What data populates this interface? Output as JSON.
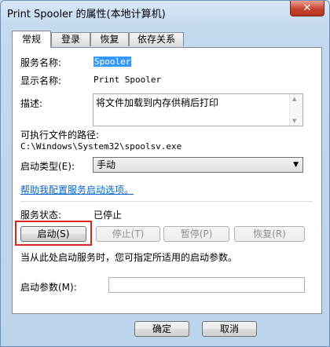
{
  "window": {
    "title": "Print Spooler 的属性(本地计算机)",
    "close_glyph": "✕"
  },
  "tabs": [
    {
      "label": "常规",
      "active": true
    },
    {
      "label": "登录",
      "active": false
    },
    {
      "label": "恢复",
      "active": false
    },
    {
      "label": "依存关系",
      "active": false
    }
  ],
  "general": {
    "service_name_label": "服务名称:",
    "service_name_value": "Spooler",
    "display_name_label": "显示名称:",
    "display_name_value": "Print Spooler",
    "description_label": "描述:",
    "description_value": "将文件加载到内存供稍后打印",
    "exe_path_label": "可执行文件的路径:",
    "exe_path_value": "C:\\Windows\\System32\\spoolsv.exe",
    "startup_type_label": "启动类型(E):",
    "startup_type_value": "手动",
    "help_link": "帮助我配置服务启动选项。",
    "status_label": "服务状态:",
    "status_value": "已停止",
    "start_button": "启动(S)",
    "stop_button": "停止(T)",
    "pause_button": "暂停(P)",
    "resume_button": "恢复(R)",
    "hint_text": "当从此处启动服务时，您可指定所适用的启动参数。",
    "start_params_label": "启动参数(M):",
    "start_params_value": ""
  },
  "footer": {
    "ok_button": "确定",
    "cancel_button": "取消"
  },
  "colors": {
    "highlight_border": "#d9261c",
    "link": "#0066cc",
    "selection": "#3399ff"
  }
}
